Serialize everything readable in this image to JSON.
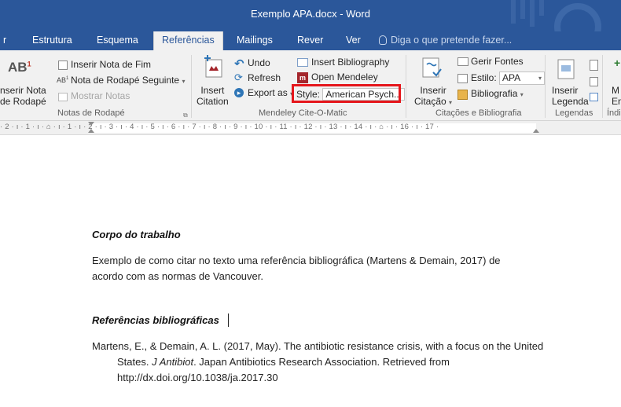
{
  "app": {
    "title": "Exemplo APA.docx - Word"
  },
  "tabs": [
    {
      "label": "r"
    },
    {
      "label": "Estrutura"
    },
    {
      "label": "Esquema"
    },
    {
      "label": "Referências",
      "active": true
    },
    {
      "label": "Mailings"
    },
    {
      "label": "Rever"
    },
    {
      "label": "Ver"
    }
  ],
  "tell_me": {
    "placeholder": "Diga o que pretende fazer..."
  },
  "ribbon": {
    "footnotes": {
      "insert_footnote_line1": "nserir Nota",
      "insert_footnote_line2": "de Rodapé",
      "insert_endnote": "Inserir Nota de Fim",
      "next_footnote": "Nota de Rodapé Seguinte",
      "show_notes": "Mostrar Notas",
      "group_label": "Notas de Rodapé"
    },
    "mendeley": {
      "insert_citation_line1": "Insert",
      "insert_citation_line2": "Citation",
      "undo": "Undo",
      "refresh": "Refresh",
      "export_as": "Export as",
      "insert_bibliography": "Insert Bibliography",
      "open_mendeley": "Open Mendeley",
      "style_label": "Style:",
      "style_value": "American Psych...",
      "group_label": "Mendeley Cite-O-Matic"
    },
    "citations": {
      "insert_citation_line1": "Inserir",
      "insert_citation_line2": "Citação",
      "manage_sources": "Gerir Fontes",
      "style_label": "Estilo:",
      "style_value": "APA",
      "bibliography": "Bibliografia",
      "group_label": "Citações e Bibliografia"
    },
    "captions": {
      "insert_caption_line1": "Inserir",
      "insert_caption_line2": "Legenda",
      "group_label": "Legendas"
    },
    "index": {
      "label_line1": "M",
      "label_line2": "En",
      "group_label": "Índi"
    }
  },
  "ruler": {
    "ticks": "· 2 · ı · 1 · ı · ⌂ · ı · 1 · ı · 2 · ı · 3 · ı · 4 · ı · 5 · ı · 6 · ı · 7 · ı · 8 · ı · 9 · ı · 10 · ı · 11 · ı · 12 · ı · 13 · ı · 14 · ı · ⌂ · ı · 16 · ı · 17 ·"
  },
  "document": {
    "heading": "Corpo do trabalho",
    "body": "Exemplo de como citar no texto uma referência bibliográfica (Martens & Demain, 2017) de acordo com as normas de Vancouver.",
    "refs_heading": "Referências bibliográficas",
    "ref_part1": "Martens, E., & Demain, A. L. (2017, May). The antibiotic resistance crisis, with a focus on the United States. ",
    "ref_journal": "J Antibiot",
    "ref_part2": ". Japan Antibiotics Research Association. Retrieved from http://dx.doi.org/10.1038/ja.2017.30"
  },
  "colors": {
    "word_blue": "#2b579a",
    "highlight_red": "#e5161b"
  }
}
